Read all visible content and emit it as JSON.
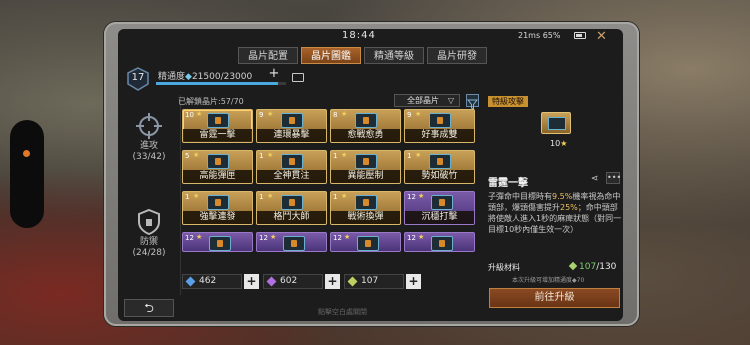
{
  "status_bar": {
    "time": "18:44",
    "network": "21ms",
    "battery": "65%"
  },
  "tabs": [
    {
      "label": "晶片配置",
      "active": false
    },
    {
      "label": "晶片圖鑑",
      "active": true
    },
    {
      "label": "精通等級",
      "active": false
    },
    {
      "label": "晶片研發",
      "active": false
    }
  ],
  "level": {
    "value": "17",
    "mastery_label": "精通度",
    "mastery_value": "21500/23000",
    "mastery_fraction": 0.935
  },
  "categories": [
    {
      "label": "進攻",
      "count": "(33/42)"
    },
    {
      "label": "防禦",
      "count": "(24/28)"
    }
  ],
  "grid": {
    "unlocked_label": "已解鎖晶片:57/70",
    "filter_value": "全部晶片",
    "cards": [
      {
        "level": "10",
        "name": "雷霆一擊",
        "rarity": "gold",
        "selected": true
      },
      {
        "level": "9",
        "name": "連環暴擊",
        "rarity": "gold",
        "selected": false
      },
      {
        "level": "8",
        "name": "愈戰愈勇",
        "rarity": "gold",
        "selected": false
      },
      {
        "level": "9",
        "name": "好事成雙",
        "rarity": "gold",
        "selected": false
      },
      {
        "level": "5",
        "name": "高能彈匣",
        "rarity": "gold",
        "selected": false
      },
      {
        "level": "1",
        "name": "全神貫注",
        "rarity": "gold",
        "selected": false
      },
      {
        "level": "1",
        "name": "異能壓制",
        "rarity": "gold",
        "selected": false
      },
      {
        "level": "1",
        "name": "勢如破竹",
        "rarity": "gold",
        "selected": false
      },
      {
        "level": "1",
        "name": "強擊連發",
        "rarity": "gold",
        "selected": false
      },
      {
        "level": "1",
        "name": "格鬥大師",
        "rarity": "gold",
        "selected": false
      },
      {
        "level": "1",
        "name": "戰術換彈",
        "rarity": "gold",
        "selected": false
      },
      {
        "level": "12",
        "name": "沉穩打擊",
        "rarity": "purple",
        "selected": false
      },
      {
        "level": "12",
        "name": "",
        "rarity": "purple",
        "selected": false
      },
      {
        "level": "12",
        "name": "",
        "rarity": "purple",
        "selected": false
      },
      {
        "level": "12",
        "name": "",
        "rarity": "purple",
        "selected": false
      },
      {
        "level": "12",
        "name": "",
        "rarity": "purple",
        "selected": false
      }
    ]
  },
  "resources": [
    {
      "value": "462",
      "color": "#5aa0e8"
    },
    {
      "value": "602",
      "color": "#b070e0"
    },
    {
      "value": "107",
      "color": "#c0d060"
    }
  ],
  "detail": {
    "tag": "特級攻擊",
    "level": "10",
    "title": "雷霆一擊",
    "desc_a": "子彈命中目標時有",
    "desc_hl1": "9.5%",
    "desc_b": "機率視為命中頭部，爆頭傷害提升",
    "desc_hl2": "25%",
    "desc_c": "；命中頭部將使敵人進入1秒的麻痺狀態（對同一目標10秒內僅生效一次）",
    "material_label": "升級材料",
    "material_have": "107",
    "material_need": "/130",
    "hint": "本次升級可增加精通度",
    "hint_value": "70",
    "upgrade_button": "前往升級"
  },
  "bottom": {
    "hint": "點擊空白處關閉"
  }
}
